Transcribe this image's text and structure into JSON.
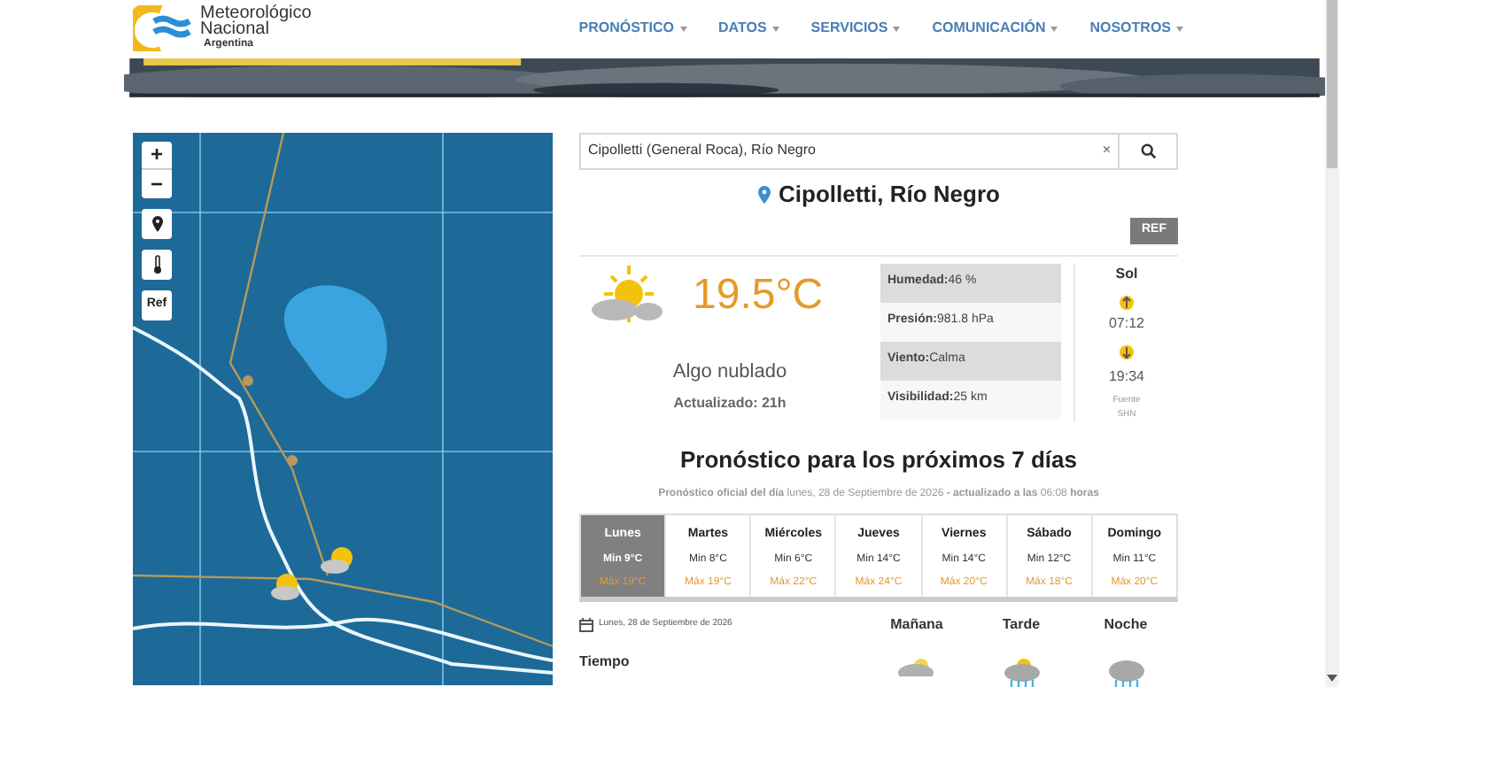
{
  "logo": {
    "lines": [
      "Meteorológico",
      "Nacional"
    ],
    "country": "Argentina"
  },
  "nav": [
    {
      "label": "PRONÓSTICO"
    },
    {
      "label": "DATOS"
    },
    {
      "label": "SERVICIOS"
    },
    {
      "label": "COMUNICACIÓN"
    },
    {
      "label": "NOSOTROS"
    }
  ],
  "map": {
    "controls": [
      {
        "kind": "zoom_in",
        "label": "+"
      },
      {
        "kind": "zoom_out",
        "label": "−"
      },
      {
        "kind": "pin"
      },
      {
        "kind": "thermometer"
      },
      {
        "kind": "text",
        "label": "Ref"
      }
    ]
  },
  "search": {
    "value": "Cipolletti (General Roca), Río Negro",
    "clear": "×"
  },
  "location": "Cipolletti, Río Negro",
  "ref_button": "REF",
  "current": {
    "temperature": "19.5°C",
    "condition": "Algo nublado",
    "updated": "Actualizado: 21h"
  },
  "details": [
    {
      "label": "Humedad:",
      "value": "46 %"
    },
    {
      "label": "Presión:",
      "value": "981.8 hPa"
    },
    {
      "label": "Viento:",
      "value": "Calma"
    },
    {
      "label": "Visibilidad:",
      "value": "25 km"
    }
  ],
  "sun": {
    "title": "Sol",
    "sunrise": "07:12",
    "sunset": "19:34",
    "source": "Fuente SHN"
  },
  "forecast": {
    "title": "Pronóstico para los próximos 7 días",
    "subtitle": "**Pronóstico oficial del día** lunes, 28 de Septiembre de 2026 **- actualizado a las** 06:08 **horas**",
    "days": [
      {
        "name": "Lunes",
        "min": "Min 9°C",
        "max": "Máx 19°C",
        "selected": true
      },
      {
        "name": "Martes",
        "min": "Min 8°C",
        "max": "Máx 19°C",
        "selected": false
      },
      {
        "name": "Miércoles",
        "min": "Min 6°C",
        "max": "Máx 22°C",
        "selected": false
      },
      {
        "name": "Jueves",
        "min": "Min 14°C",
        "max": "Máx 24°C",
        "selected": false
      },
      {
        "name": "Viernes",
        "min": "Min 14°C",
        "max": "Máx 20°C",
        "selected": false
      },
      {
        "name": "Sábado",
        "min": "Min 12°C",
        "max": "Máx 18°C",
        "selected": false
      },
      {
        "name": "Domingo",
        "min": "Min 11°C",
        "max": "Máx 20°C",
        "selected": false
      }
    ],
    "date": "Lunes, 28 de Septiembre de 2026",
    "periods": [
      {
        "label": "Mañana",
        "kind": "cloudy"
      },
      {
        "label": "Tarde",
        "kind": "rain_sun"
      },
      {
        "label": "Noche",
        "kind": "rain"
      }
    ],
    "row_label": "Tiempo"
  }
}
